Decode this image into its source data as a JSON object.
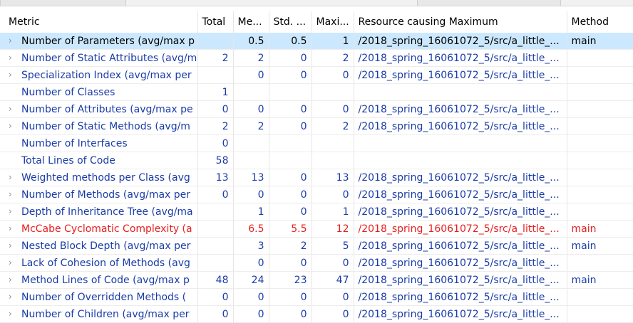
{
  "headers": {
    "metric": "Metric",
    "total": "Total",
    "mean": "Me...",
    "std": "Std. ...",
    "max": "Maxi...",
    "resource": "Resource causing Maximum",
    "method": "Method"
  },
  "rows": [
    {
      "metric": "Number of Parameters (avg/max p",
      "total": "",
      "mean": "0.5",
      "std": "0.5",
      "max": "1",
      "resource": "/2018_spring_16061072_5/src/a_little_...",
      "method": "main",
      "expandable": true,
      "selected": true,
      "warn": false
    },
    {
      "metric": "Number of Static Attributes (avg/m",
      "total": "2",
      "mean": "2",
      "std": "0",
      "max": "2",
      "resource": "/2018_spring_16061072_5/src/a_little_...",
      "method": "",
      "expandable": true,
      "selected": false,
      "warn": false
    },
    {
      "metric": "Specialization Index (avg/max per",
      "total": "",
      "mean": "0",
      "std": "0",
      "max": "0",
      "resource": "/2018_spring_16061072_5/src/a_little_...",
      "method": "",
      "expandable": true,
      "selected": false,
      "warn": false
    },
    {
      "metric": "Number of Classes",
      "total": "1",
      "mean": "",
      "std": "",
      "max": "",
      "resource": "",
      "method": "",
      "expandable": false,
      "selected": false,
      "warn": false
    },
    {
      "metric": "Number of Attributes (avg/max pe",
      "total": "0",
      "mean": "0",
      "std": "0",
      "max": "0",
      "resource": "/2018_spring_16061072_5/src/a_little_...",
      "method": "",
      "expandable": true,
      "selected": false,
      "warn": false
    },
    {
      "metric": "Number of Static Methods (avg/m",
      "total": "2",
      "mean": "2",
      "std": "0",
      "max": "2",
      "resource": "/2018_spring_16061072_5/src/a_little_...",
      "method": "",
      "expandable": true,
      "selected": false,
      "warn": false
    },
    {
      "metric": "Number of Interfaces",
      "total": "0",
      "mean": "",
      "std": "",
      "max": "",
      "resource": "",
      "method": "",
      "expandable": false,
      "selected": false,
      "warn": false
    },
    {
      "metric": "Total Lines of Code",
      "total": "58",
      "mean": "",
      "std": "",
      "max": "",
      "resource": "",
      "method": "",
      "expandable": false,
      "selected": false,
      "warn": false
    },
    {
      "metric": "Weighted methods per Class (avg",
      "total": "13",
      "mean": "13",
      "std": "0",
      "max": "13",
      "resource": "/2018_spring_16061072_5/src/a_little_...",
      "method": "",
      "expandable": true,
      "selected": false,
      "warn": false
    },
    {
      "metric": "Number of Methods (avg/max per",
      "total": "0",
      "mean": "0",
      "std": "0",
      "max": "0",
      "resource": "/2018_spring_16061072_5/src/a_little_...",
      "method": "",
      "expandable": true,
      "selected": false,
      "warn": false
    },
    {
      "metric": "Depth of Inheritance Tree (avg/ma",
      "total": "",
      "mean": "1",
      "std": "0",
      "max": "1",
      "resource": "/2018_spring_16061072_5/src/a_little_...",
      "method": "",
      "expandable": true,
      "selected": false,
      "warn": false
    },
    {
      "metric": "McCabe Cyclomatic Complexity (a",
      "total": "",
      "mean": "6.5",
      "std": "5.5",
      "max": "12",
      "resource": "/2018_spring_16061072_5/src/a_little_...",
      "method": "main",
      "expandable": true,
      "selected": false,
      "warn": true
    },
    {
      "metric": "Nested Block Depth (avg/max per",
      "total": "",
      "mean": "3",
      "std": "2",
      "max": "5",
      "resource": "/2018_spring_16061072_5/src/a_little_...",
      "method": "main",
      "expandable": true,
      "selected": false,
      "warn": false
    },
    {
      "metric": "Lack of Cohesion of Methods (avg",
      "total": "",
      "mean": "0",
      "std": "0",
      "max": "0",
      "resource": "/2018_spring_16061072_5/src/a_little_...",
      "method": "",
      "expandable": true,
      "selected": false,
      "warn": false
    },
    {
      "metric": "Method Lines of Code (avg/max p",
      "total": "48",
      "mean": "24",
      "std": "23",
      "max": "47",
      "resource": "/2018_spring_16061072_5/src/a_little_...",
      "method": "main",
      "expandable": true,
      "selected": false,
      "warn": false
    },
    {
      "metric": "Number of Overridden Methods (",
      "total": "0",
      "mean": "0",
      "std": "0",
      "max": "0",
      "resource": "/2018_spring_16061072_5/src/a_little_...",
      "method": "",
      "expandable": true,
      "selected": false,
      "warn": false
    },
    {
      "metric": "Number of Children (avg/max per",
      "total": "0",
      "mean": "0",
      "std": "0",
      "max": "0",
      "resource": "/2018_spring_16061072_5/src/a_little_...",
      "method": "",
      "expandable": true,
      "selected": false,
      "warn": false
    }
  ],
  "icons": {
    "expand": "chevron-right-icon"
  },
  "colors": {
    "link": "#1a3ca8",
    "warn": "#e81e1e",
    "selected_bg": "#cce8ff"
  }
}
